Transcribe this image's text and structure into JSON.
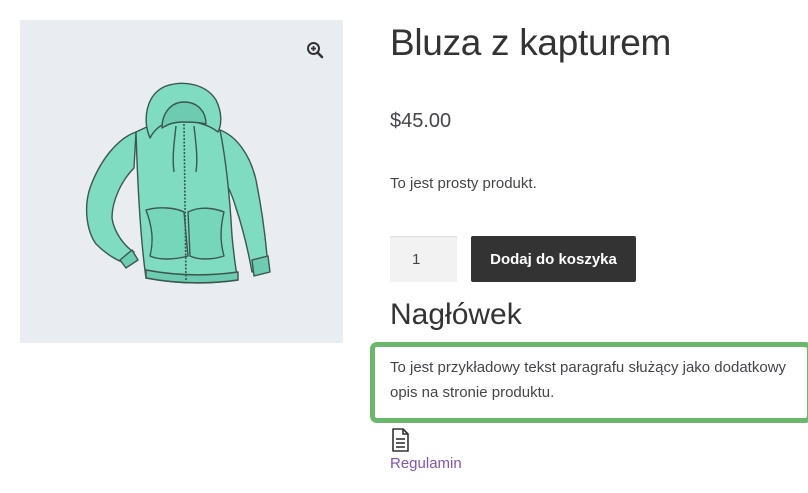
{
  "product": {
    "title": "Bluza z kapturem",
    "price": "$45.00",
    "short_description": "To jest prosty produkt.",
    "image_subject": "hoodie-image",
    "quantity": "1",
    "add_to_cart_label": "Dodaj do koszyka"
  },
  "gallery": {
    "zoom_icon": "zoom-in-icon",
    "background": "#e9edf1"
  },
  "description": {
    "heading": "Nagłówek",
    "paragraph": "To jest przykładowy tekst paragrafu służący jako dodatkowy opis na stronie produktu.",
    "highlight_color": "#6bb76b"
  },
  "file": {
    "icon": "document-icon",
    "link_label": "Regulamin",
    "link_color": "#7f54b3"
  },
  "colors": {
    "button_bg": "#333333",
    "button_text": "#ffffff",
    "hoodie": "#7fdcc0"
  }
}
